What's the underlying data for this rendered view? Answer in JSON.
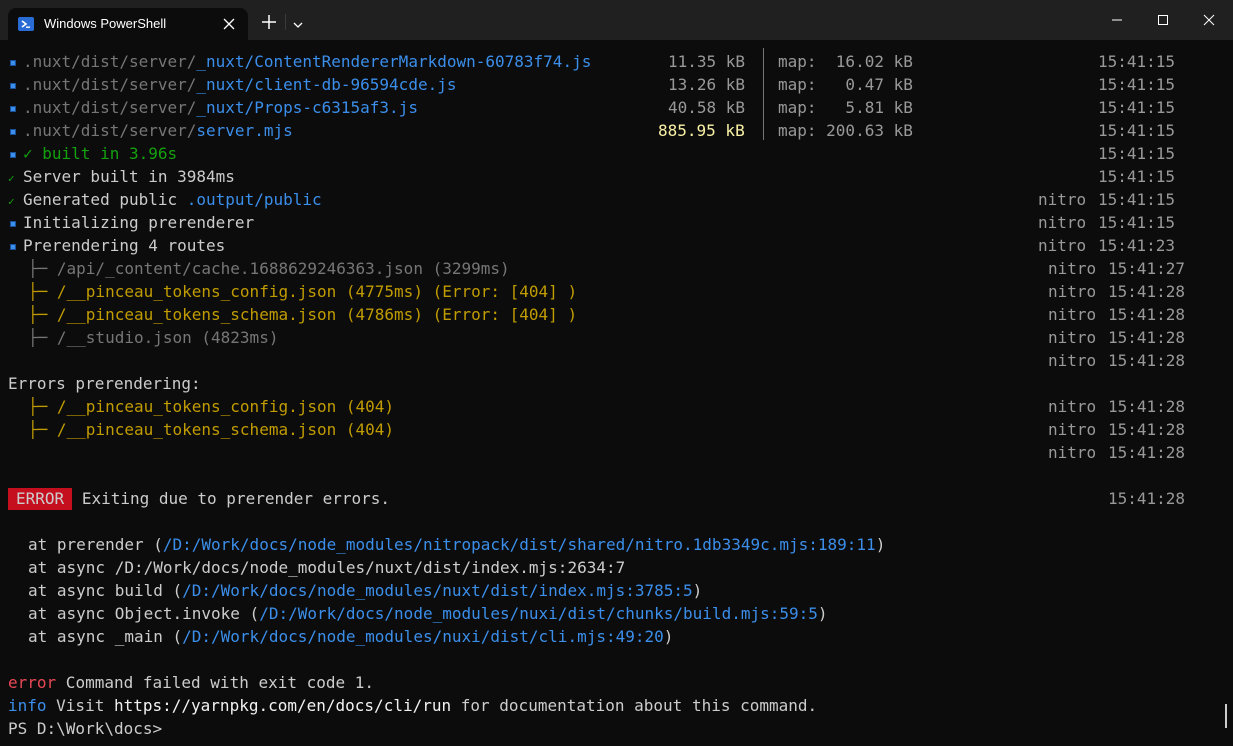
{
  "window": {
    "tab_title": "Windows PowerShell",
    "icons": [
      "powershell-icon",
      "close-icon",
      "plus-icon",
      "chevron-down-icon",
      "minimize-icon",
      "maximize-icon",
      "close-icon"
    ]
  },
  "build_files": [
    {
      "prefix": ".nuxt/dist/server/",
      "name": "_nuxt/ContentRendererMarkdown-60783f74.js",
      "size": "11.35 kB",
      "map": "map:  16.02 kB",
      "time": "15:41:15"
    },
    {
      "prefix": ".nuxt/dist/server/",
      "name": "_nuxt/client-db-96594cde.js",
      "size": "13.26 kB",
      "map": "map:   0.47 kB",
      "time": "15:41:15"
    },
    {
      "prefix": ".nuxt/dist/server/",
      "name": "_nuxt/Props-c6315af3.js",
      "size": "40.58 kB",
      "map": "map:   5.81 kB",
      "time": "15:41:15"
    },
    {
      "prefix": ".nuxt/dist/server/",
      "name": "server.mjs",
      "size": "885.95 kB",
      "map": "map: 200.63 kB",
      "time": "15:41:15"
    }
  ],
  "status_lines": {
    "built": {
      "text": "✓ built in 3.96s",
      "time": "15:41:15"
    },
    "server_built": {
      "text": "Server built in 3984ms",
      "time": "15:41:15"
    },
    "generated": {
      "text": "Generated public ",
      "path": ".output/public",
      "tag": "nitro",
      "time": "15:41:15"
    },
    "init": {
      "text": "Initializing prerenderer",
      "tag": "nitro",
      "time": "15:41:15"
    },
    "prerendering": {
      "text": "Prerendering 4 routes",
      "tag": "nitro",
      "time": "15:41:23"
    }
  },
  "routes": [
    {
      "text": "├─ /api/_content/cache.1688629246363.json (3299ms)",
      "tag": "nitro",
      "time": "15:41:27"
    },
    {
      "text": "├─ /__pinceau_tokens_config.json (4775ms) (Error: [404] )",
      "tag": "nitro",
      "time": "15:41:28"
    },
    {
      "text": "├─ /__pinceau_tokens_schema.json (4786ms) (Error: [404] )",
      "tag": "nitro",
      "time": "15:41:28"
    },
    {
      "text": "├─ /__studio.json (4823ms)",
      "tag": "nitro",
      "time": "15:41:28"
    }
  ],
  "route_trailer": {
    "tag": "nitro",
    "time": "15:41:28"
  },
  "errors_header": "Errors prerendering:",
  "error_routes": [
    {
      "text": "├─ /__pinceau_tokens_config.json (404)",
      "tag": "nitro",
      "time": "15:41:28"
    },
    {
      "text": "├─ /__pinceau_tokens_schema.json (404)",
      "tag": "nitro",
      "time": "15:41:28"
    }
  ],
  "error_trailer": {
    "tag": "nitro",
    "time": "15:41:28"
  },
  "error_badge": "ERROR",
  "error_message": "Exiting due to prerender errors.",
  "error_time": "15:41:28",
  "stack": [
    {
      "pre": "at prerender (",
      "link": "/D:/Work/docs/node_modules/nitropack/dist/shared/nitro.1db3349c.mjs:189:11",
      "post": ")"
    },
    {
      "pre": "at async /D:/Work/docs/node_modules/nuxt/dist/index.mjs:2634:7",
      "link": "",
      "post": ""
    },
    {
      "pre": "at async build (",
      "link": "/D:/Work/docs/node_modules/nuxt/dist/index.mjs:3785:5",
      "post": ")"
    },
    {
      "pre": "at async Object.invoke (",
      "link": "/D:/Work/docs/node_modules/nuxi/dist/chunks/build.mjs:59:5",
      "post": ")"
    },
    {
      "pre": "at async _main (",
      "link": "/D:/Work/docs/node_modules/nuxi/dist/cli.mjs:49:20",
      "post": ")"
    }
  ],
  "yarn_error": {
    "label": "error",
    "text": " Command failed with exit code 1."
  },
  "yarn_info": {
    "label": "info",
    "pre": " Visit ",
    "url": "https://yarnpkg.com/en/docs/cli/run",
    "post": " for documentation about this command."
  },
  "prompt": "PS D:\\Work\\docs>"
}
